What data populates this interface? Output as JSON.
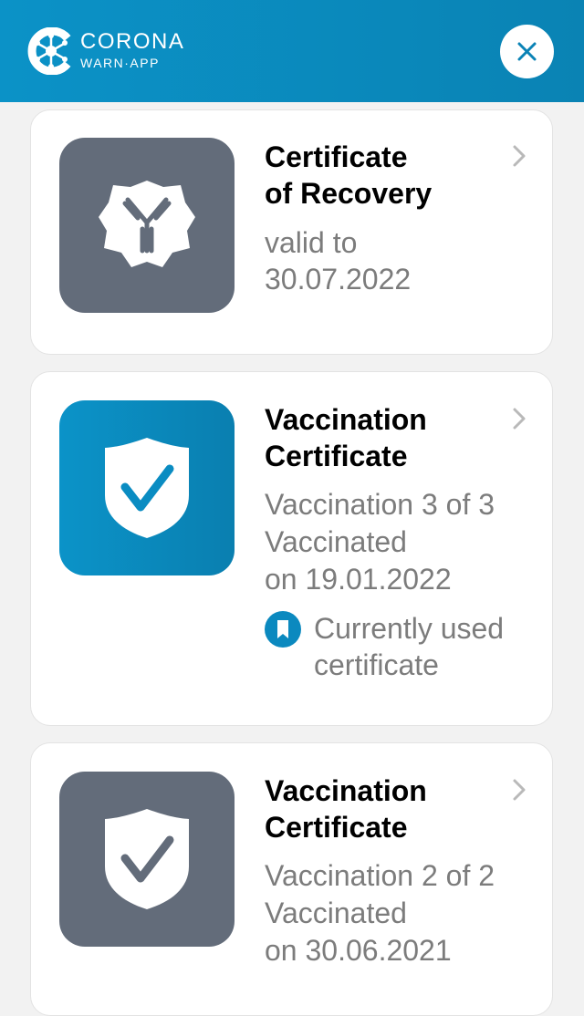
{
  "header": {
    "brand_line1": "CORONA",
    "brand_line2": "WARN·APP",
    "logo_icon": "corona-warn-app-logo-icon",
    "close_icon": "close-icon",
    "background_color": "#0b92c7"
  },
  "cards": [
    {
      "title_line1": "Certificate",
      "title_line2": "of Recovery",
      "detail_line1": "valid to",
      "detail_line2": "30.07.2022",
      "icon": "antibody-icon",
      "tile_color": "#636c7a"
    },
    {
      "title_line1": "Vaccination",
      "title_line2": "Certificate",
      "detail_line1": "Vaccination 3 of 3",
      "detail_line2": "Vaccinated",
      "detail_line3": "on 19.01.2022",
      "badge_line1": "Currently used",
      "badge_line2": "certificate",
      "badge_icon": "bookmark-icon",
      "icon": "shield-check-icon",
      "tile_color": "#0b93c8"
    },
    {
      "title_line1": "Vaccination",
      "title_line2": "Certificate",
      "detail_line1": "Vaccination 2 of 2",
      "detail_line2": "Vaccinated",
      "detail_line3": "on 30.06.2021",
      "icon": "shield-check-icon",
      "tile_color": "#636c7a"
    }
  ]
}
